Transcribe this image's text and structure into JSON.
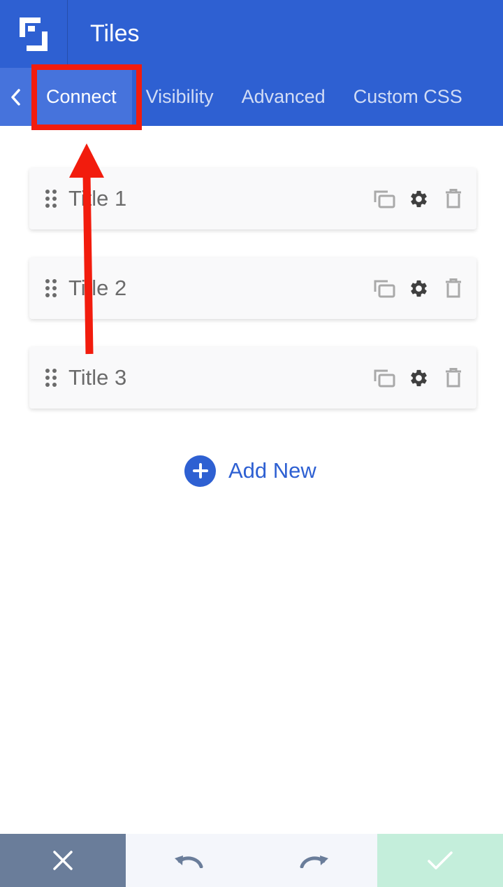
{
  "header": {
    "title": "Tiles",
    "logo_icon": "brand-logo-icon"
  },
  "tabs": [
    {
      "label": "Connect",
      "active": true
    },
    {
      "label": "Visibility",
      "active": false
    },
    {
      "label": "Advanced",
      "active": false
    },
    {
      "label": "Custom CSS",
      "active": false
    }
  ],
  "items": [
    {
      "title": "Title 1"
    },
    {
      "title": "Title 2"
    },
    {
      "title": "Title 3"
    }
  ],
  "add_new": {
    "label": "Add New"
  },
  "icons": {
    "back": "chevron-left-icon",
    "drag": "drag-handle-icon",
    "duplicate": "duplicate-icon",
    "settings": "gear-icon",
    "delete": "trash-icon",
    "add": "plus-circle-icon",
    "close": "close-icon",
    "undo": "undo-icon",
    "redo": "redo-icon",
    "save": "check-icon"
  },
  "colors": {
    "primary": "#2e60d2",
    "tab_active": "#4673dc",
    "annotation": "#f21c0d",
    "footer_close": "#6a7d9a",
    "footer_save": "#c4eedb"
  }
}
